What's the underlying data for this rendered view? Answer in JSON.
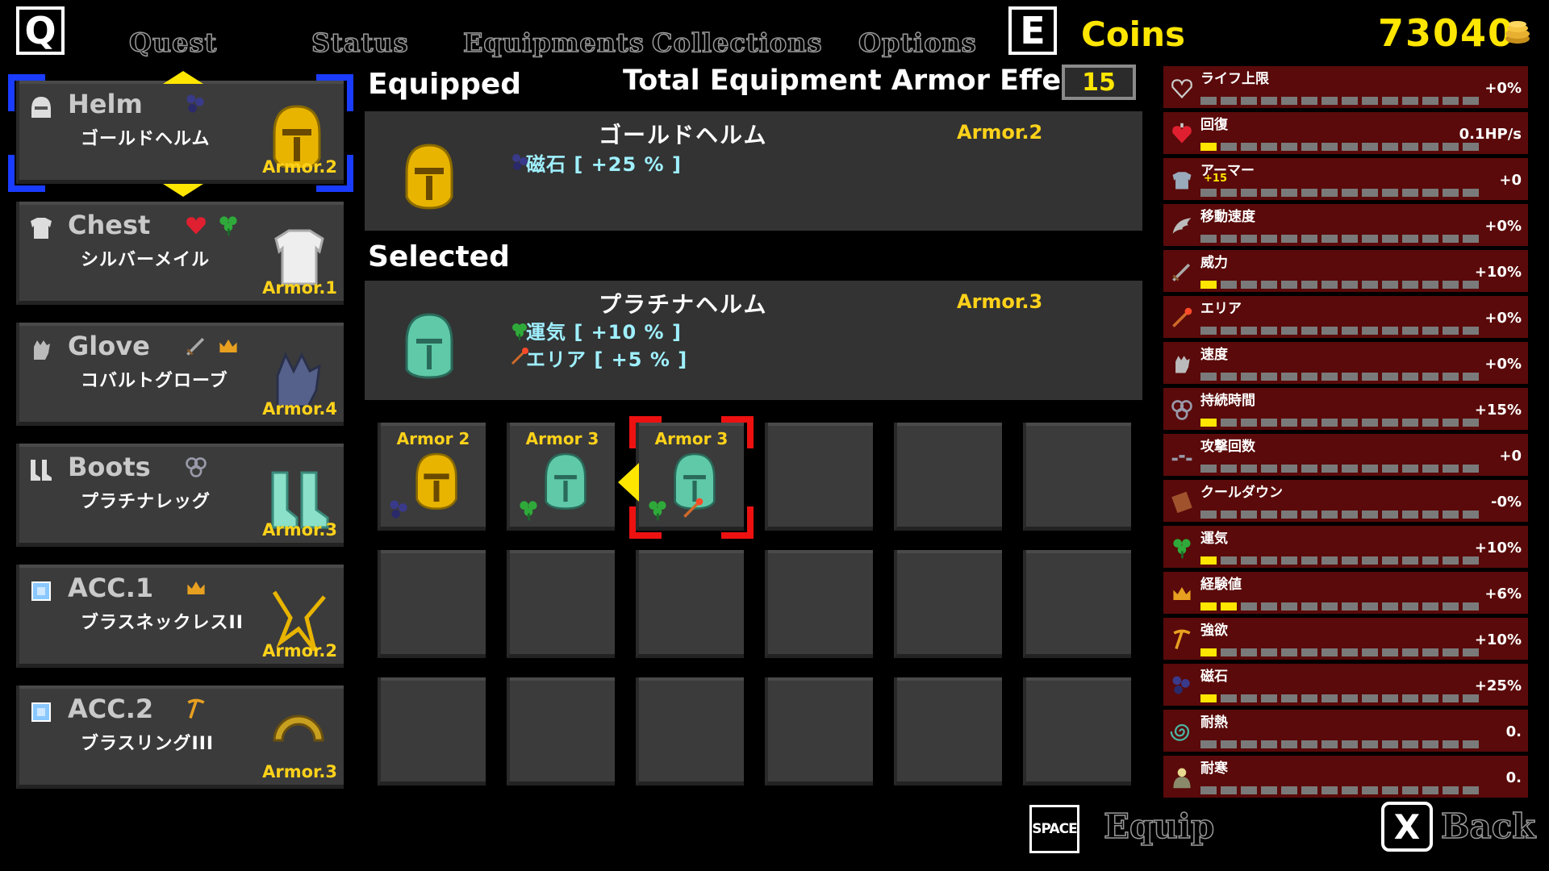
{
  "keys": {
    "q": "Q",
    "e": "E",
    "space": "SPACE",
    "x": "X"
  },
  "tabs": [
    "Quest",
    "Status",
    "Equipments",
    "Collections",
    "Options"
  ],
  "coins": {
    "label": "Coins",
    "value": "73040"
  },
  "headers": {
    "equipped": "Equipped",
    "selected": "Selected",
    "total_label": "Total Equipment Armor Effect",
    "total_value": "15"
  },
  "slots": [
    {
      "title": "Helm",
      "name": "ゴールドヘルム",
      "armor": "Armor.2",
      "icon": "helm-icon",
      "bonuses": [
        "magnet-icon"
      ]
    },
    {
      "title": "Chest",
      "name": "シルバーメイル",
      "armor": "Armor.1",
      "icon": "chest-icon",
      "bonuses": [
        "heart-icon",
        "clover-icon"
      ]
    },
    {
      "title": "Glove",
      "name": "コバルトグローブ",
      "armor": "Armor.4",
      "icon": "glove-icon",
      "bonuses": [
        "sword-icon",
        "crown-icon"
      ]
    },
    {
      "title": "Boots",
      "name": "プラチナレッグ",
      "armor": "Armor.3",
      "icon": "boots-icon",
      "bonuses": [
        "bullseye-icon"
      ]
    },
    {
      "title": "ACC.1",
      "name": "ブラスネックレスII",
      "armor": "Armor.2",
      "icon": "gem-icon",
      "bonuses": [
        "crown-icon"
      ]
    },
    {
      "title": "ACC.2",
      "name": "ブラスリングIII",
      "armor": "Armor.3",
      "icon": "gem-icon",
      "bonuses": [
        "pickaxe-icon"
      ]
    }
  ],
  "equipped": {
    "name": "ゴールドヘルム",
    "armor": "Armor.2",
    "lines": [
      {
        "icon": "magnet-icon",
        "text": "磁石 [ +25 % ]"
      }
    ]
  },
  "selected": {
    "name": "プラチナヘルム",
    "armor": "Armor.3",
    "lines": [
      {
        "icon": "clover-icon",
        "text": "運気 [ +10 % ]"
      },
      {
        "icon": "wand-icon",
        "text": "エリア [ +5 % ]"
      }
    ]
  },
  "grid": [
    {
      "label": "Armor 2",
      "item": "gold-helm",
      "bonuses": [
        "magnet-icon"
      ]
    },
    {
      "label": "Armor 3",
      "item": "platinum-helm",
      "bonuses": [
        "clover-icon"
      ]
    },
    {
      "label": "Armor 3",
      "item": "platinum-helm",
      "bonuses": [
        "clover-icon",
        "wand-icon"
      ],
      "selected": true
    },
    {
      "label": "",
      "item": ""
    },
    {
      "label": "",
      "item": ""
    },
    {
      "label": "",
      "item": ""
    },
    {
      "label": "",
      "item": ""
    },
    {
      "label": "",
      "item": ""
    },
    {
      "label": "",
      "item": ""
    },
    {
      "label": "",
      "item": ""
    },
    {
      "label": "",
      "item": ""
    },
    {
      "label": "",
      "item": ""
    },
    {
      "label": "",
      "item": ""
    },
    {
      "label": "",
      "item": ""
    },
    {
      "label": "",
      "item": ""
    },
    {
      "label": "",
      "item": ""
    },
    {
      "label": "",
      "item": ""
    },
    {
      "label": "",
      "item": ""
    }
  ],
  "stats": [
    {
      "label": "ライフ上限",
      "value": "+0%",
      "filled": 0,
      "icon": "heart-outline-icon"
    },
    {
      "label": "回復",
      "value": "0.1HP/s",
      "filled": 1,
      "icon": "heart-potion-icon"
    },
    {
      "label": "アーマー",
      "sub": "+15",
      "value": "+0",
      "filled": 0,
      "icon": "armor-icon"
    },
    {
      "label": "移動速度",
      "value": "+0%",
      "filled": 0,
      "icon": "wing-icon"
    },
    {
      "label": "威力",
      "value": "+10%",
      "filled": 1,
      "icon": "sword-icon"
    },
    {
      "label": "エリア",
      "value": "+0%",
      "filled": 0,
      "icon": "wand-icon"
    },
    {
      "label": "速度",
      "value": "+0%",
      "filled": 0,
      "icon": "glove-icon"
    },
    {
      "label": "持続時間",
      "value": "+15%",
      "filled": 1,
      "icon": "bullseye-icon"
    },
    {
      "label": "攻撃回数",
      "value": "+0",
      "filled": 0,
      "icon": "multishot-icon"
    },
    {
      "label": "クールダウン",
      "value": "-0%",
      "filled": 0,
      "icon": "book-icon"
    },
    {
      "label": "運気",
      "value": "+10%",
      "filled": 1,
      "icon": "clover-icon"
    },
    {
      "label": "経験値",
      "value": "+6%",
      "filled": 2,
      "icon": "crown-icon"
    },
    {
      "label": "強欲",
      "value": "+10%",
      "filled": 1,
      "icon": "pickaxe-icon"
    },
    {
      "label": "磁石",
      "value": "+25%",
      "filled": 1,
      "icon": "magnet-icon"
    },
    {
      "label": "耐熱",
      "value": "0.",
      "filled": 0,
      "icon": "swirl-icon"
    },
    {
      "label": "耐寒",
      "value": "0.",
      "filled": 0,
      "icon": "snowman-icon"
    }
  ],
  "bottom": {
    "equip": "Equip",
    "back": "Back"
  },
  "colors": {
    "accent": "#ffe600",
    "armor_text": "#ffd21a",
    "stat_bg": "#5a0a0a",
    "selection_blue": "#1a3cff",
    "selection_red": "#ee1111"
  }
}
